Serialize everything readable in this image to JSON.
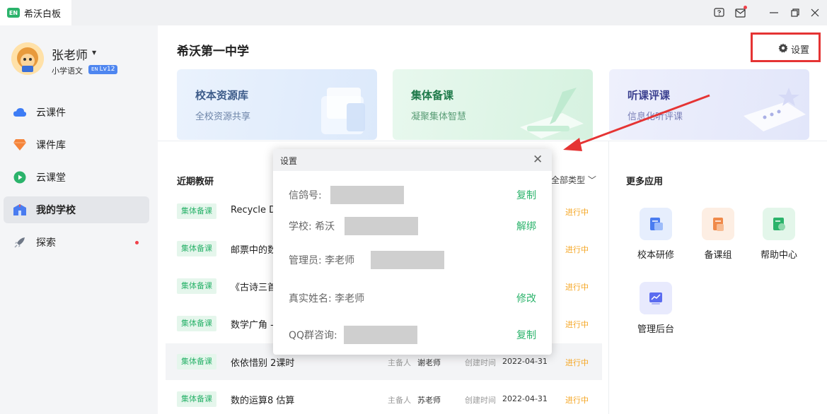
{
  "titlebar": {
    "logo_text": "EN",
    "app_name": "希沃白板",
    "icons": [
      "help-icon",
      "mail-icon",
      "minimize-icon",
      "restore-icon",
      "close-icon"
    ]
  },
  "user": {
    "name": "张老师",
    "subject": "小学语文",
    "level_badge": "Lv12",
    "level_badge_prefix": "EN"
  },
  "sidebar": {
    "items": [
      {
        "label": "云课件",
        "icon": "cloud-icon",
        "active": false
      },
      {
        "label": "课件库",
        "icon": "diamond-icon",
        "active": false
      },
      {
        "label": "云课堂",
        "icon": "play-icon",
        "active": false
      },
      {
        "label": "我的学校",
        "icon": "school-icon",
        "active": true
      },
      {
        "label": "探索",
        "icon": "rocket-icon",
        "active": false,
        "dot": true
      }
    ]
  },
  "main": {
    "school_name": "希沃第一中学",
    "settings_label": "设置",
    "cards": [
      {
        "title": "校本资源库",
        "subtitle": "全校资源共享",
        "color": "#3e5c8a"
      },
      {
        "title": "集体备课",
        "subtitle": "凝聚集体智慧",
        "color": "#1f7a4a"
      },
      {
        "title": "听课评课",
        "subtitle": "信息化听评课",
        "color": "#3a3f8f"
      }
    ],
    "recent_title": "近期教研",
    "filter_label": "全部类型",
    "rows": [
      {
        "tag": "集体备课",
        "title": "Recycle D",
        "status": "进行中"
      },
      {
        "tag": "集体备课",
        "title": "邮票中的数",
        "status": "进行中"
      },
      {
        "tag": "集体备课",
        "title": "《古诗三首",
        "status": "进行中"
      },
      {
        "tag": "集体备课",
        "title": "数学广角 -",
        "status": "进行中"
      },
      {
        "tag": "集体备课",
        "title": "依依惜别 2课时",
        "host_label": "主备人",
        "host": "谢老师",
        "created_label": "创建时间",
        "date": "2022-04-31",
        "status": "进行中"
      },
      {
        "tag": "集体备课",
        "title": "数的运算8  估算",
        "host_label": "主备人",
        "host": "苏老师",
        "created_label": "创建时间",
        "date": "2022-04-31",
        "status": "进行中"
      }
    ],
    "more_apps_title": "更多应用",
    "apps": [
      {
        "label": "校本研修",
        "icon": "study-icon",
        "color": "#4a7cf0"
      },
      {
        "label": "备课组",
        "icon": "group-icon",
        "color": "#f08a4a"
      },
      {
        "label": "帮助中心",
        "icon": "help-doc-icon",
        "color": "#2bb36b"
      },
      {
        "label": "管理后台",
        "icon": "admin-chart-icon",
        "color": "#5b6cf0"
      }
    ]
  },
  "dialog": {
    "title": "设置",
    "rows": [
      {
        "label": "信鸽号:",
        "action": "复制"
      },
      {
        "label": "学校: 希沃",
        "action": "解绑"
      },
      {
        "label": "管理员: 李老师",
        "action": ""
      },
      {
        "label": "真实姓名: 李老师",
        "action": "修改"
      },
      {
        "label": "QQ群咨询:",
        "action": "复制"
      }
    ]
  },
  "colors": {
    "accent_green": "#2bb36b",
    "status_orange": "#f5a623",
    "highlight_red": "#e53434"
  }
}
